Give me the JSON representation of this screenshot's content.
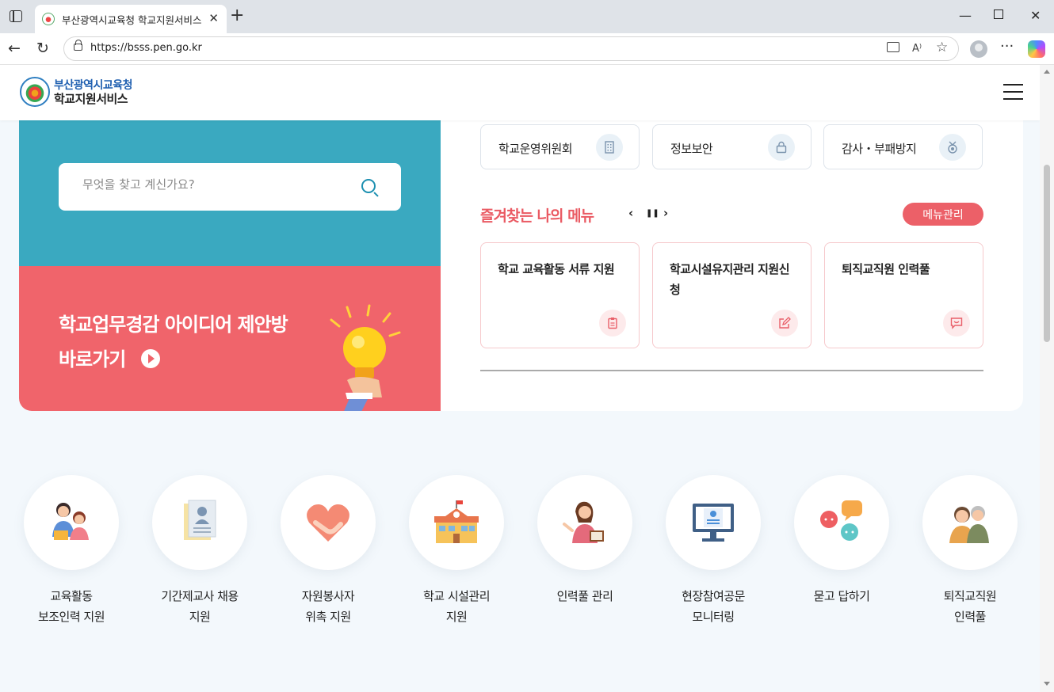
{
  "browser": {
    "tab_title": "부산광역시교육청 학교지원서비스",
    "url": "https://bsss.pen.go.kr"
  },
  "header": {
    "logo_line1": "부산광역시교육청",
    "logo_line2": "학교지원서비스"
  },
  "search": {
    "placeholder": "무엇을 찾고 계신가요?"
  },
  "idea_banner": {
    "line1": "학교업무경감 아이디어 제안방",
    "line2": "바로가기"
  },
  "quick_links": [
    {
      "label": "학교운영위원회",
      "icon": "building-icon"
    },
    {
      "label": "정보보안",
      "icon": "lock-icon"
    },
    {
      "label": "감사・부패방지",
      "icon": "medal-icon"
    }
  ],
  "favorites": {
    "title": "즐겨찾는 나의 메뉴",
    "prev": "‹",
    "pause": "❚❚",
    "next": "›",
    "manage_label": "메뉴관리",
    "items": [
      {
        "label": "학교 교육활동 서류 지원",
        "icon": "clipboard-icon"
      },
      {
        "label": "학교시설유지관리 지원신청",
        "icon": "edit-icon"
      },
      {
        "label": "퇴직교직원 인력풀",
        "icon": "chat-icon"
      }
    ]
  },
  "services": [
    {
      "line1": "교육활동",
      "line2": "보조인력 지원",
      "icon": "teachers-icon"
    },
    {
      "line1": "기간제교사 채용",
      "line2": "지원",
      "icon": "resume-icon"
    },
    {
      "line1": "자원봉사자",
      "line2": "위촉 지원",
      "icon": "heart-handshake-icon"
    },
    {
      "line1": "학교 시설관리",
      "line2": "지원",
      "icon": "school-building-icon"
    },
    {
      "line1": "인력풀 관리",
      "line2": "",
      "icon": "presenter-icon"
    },
    {
      "line1": "현장참여공문",
      "line2": "모니터링",
      "icon": "monitor-icon"
    },
    {
      "line1": "묻고 답하기",
      "line2": "",
      "icon": "speech-bubbles-icon"
    },
    {
      "line1": "퇴직교직원",
      "line2": "인력풀",
      "icon": "seniors-icon"
    }
  ],
  "colors": {
    "teal": "#3aa9c0",
    "coral": "#f0646b",
    "accent_text": "#ea5a63",
    "brand_blue": "#1f5fb0"
  }
}
